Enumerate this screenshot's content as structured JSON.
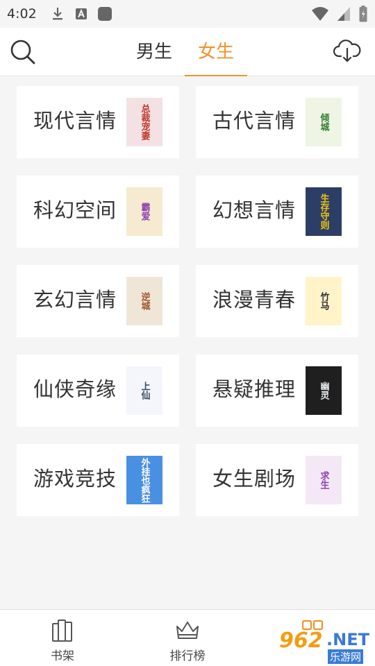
{
  "status": {
    "time": "4:02"
  },
  "tabs": {
    "male": "男生",
    "female": "女生"
  },
  "categories": [
    {
      "label": "现代言情",
      "cover_text": "总裁宠妻",
      "cover_bg": "#f3e1e4",
      "cover_fg": "#c0392b"
    },
    {
      "label": "古代言情",
      "cover_text": "倾城",
      "cover_bg": "#eef5e4",
      "cover_fg": "#2e7d32"
    },
    {
      "label": "科幻空间",
      "cover_text": "霸爱",
      "cover_bg": "#f6ead0",
      "cover_fg": "#8e44ad"
    },
    {
      "label": "幻想言情",
      "cover_text": "生存守则",
      "cover_bg": "#2c3e66",
      "cover_fg": "#f1c40f"
    },
    {
      "label": "玄幻言情",
      "cover_text": "逆城",
      "cover_bg": "#f0e6d8",
      "cover_fg": "#a0522d"
    },
    {
      "label": "浪漫青春",
      "cover_text": "竹马",
      "cover_bg": "#fff4c9",
      "cover_fg": "#2d2d2d"
    },
    {
      "label": "仙侠奇缘",
      "cover_text": "上仙",
      "cover_bg": "#f4f6fb",
      "cover_fg": "#34495e"
    },
    {
      "label": "悬疑推理",
      "cover_text": "幽灵",
      "cover_bg": "#1f1f1f",
      "cover_fg": "#ecf0f1"
    },
    {
      "label": "游戏竞技",
      "cover_text": "外挂也疯狂",
      "cover_bg": "#4a90e2",
      "cover_fg": "#ffffff"
    },
    {
      "label": "女生剧场",
      "cover_text": "求生",
      "cover_bg": "#f5e8f6",
      "cover_fg": "#8e44ad"
    }
  ],
  "bottom_nav": {
    "bookshelf": "书架",
    "ranking": "排行榜"
  },
  "watermark": {
    "num": "962",
    "net": ".NET",
    "site": "乐游网"
  },
  "colors": {
    "accent": "#f0932b",
    "text": "#333333",
    "background": "#f5f5f5"
  }
}
